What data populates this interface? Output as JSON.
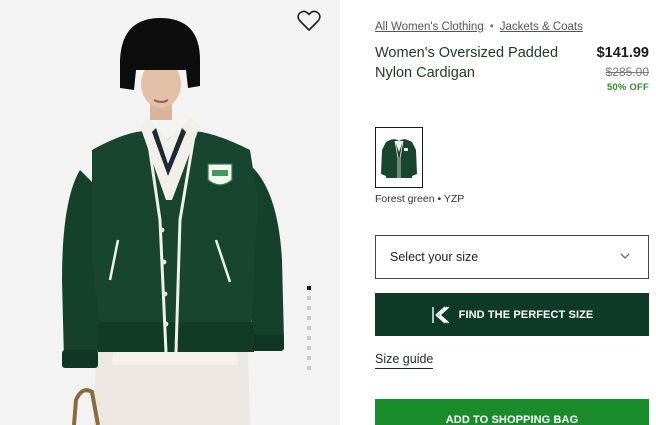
{
  "breadcrumb": {
    "items": [
      "All Women's Clothing",
      "Jackets & Coats"
    ],
    "separator": "•"
  },
  "product": {
    "title": "Women's Oversized Padded Nylon Cardigan",
    "price_current": "$141.99",
    "price_original": "$285.00",
    "discount": "50% OFF"
  },
  "color": {
    "label": "Forest green • YZP",
    "swatch_color": "#0e3b27"
  },
  "size_select": {
    "placeholder": "Select your size"
  },
  "find_size_button": {
    "label": "FIND THE PERFECT SIZE",
    "icon": "ruler-k-icon"
  },
  "size_guide": {
    "label": "Size guide"
  },
  "add_to_bag": {
    "label": "ADD TO SHOPPING BAG"
  },
  "gallery": {
    "image_count": 9,
    "active_index": 0,
    "wishlist_icon": "heart-icon"
  },
  "colors": {
    "brand_dark_green": "#0e3b27",
    "cta_green": "#1b8c2c",
    "discount_green": "#2e8b2e"
  }
}
